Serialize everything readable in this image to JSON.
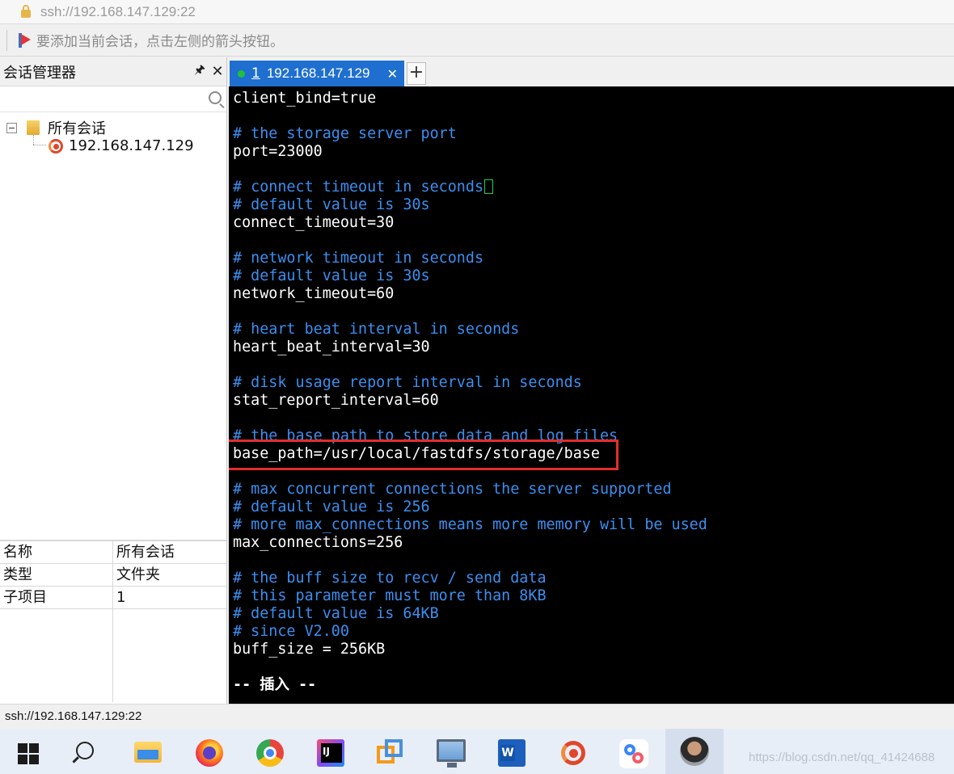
{
  "address_bar": {
    "text": "ssh://192.168.147.129:22"
  },
  "hint_bar": {
    "text": "要添加当前会话，点击左侧的箭头按钮。"
  },
  "session_manager": {
    "title": "会话管理器",
    "pin_glyph": "🖈",
    "close_glyph": "✕",
    "search_placeholder": "",
    "tree": {
      "root_label": "所有会话",
      "children": [
        {
          "label": "192.168.147.129"
        }
      ]
    }
  },
  "properties": {
    "rows": [
      {
        "key": "名称",
        "value": "所有会话"
      },
      {
        "key": "类型",
        "value": "文件夹"
      },
      {
        "key": "子项目",
        "value": "1"
      }
    ]
  },
  "tabs": {
    "active": {
      "number": "1",
      "label": "192.168.147.129",
      "close_glyph": "✕"
    },
    "add_glyph": "+"
  },
  "terminal": {
    "lines": [
      "client_bind=true",
      "",
      "# the storage server port",
      "port=23000",
      "",
      "# connect timeout in seconds",
      "# default value is 30s",
      "connect_timeout=30",
      "",
      "# network timeout in seconds",
      "# default value is 30s",
      "network_timeout=60",
      "",
      "# heart beat interval in seconds",
      "heart_beat_interval=30",
      "",
      "# disk usage report interval in seconds",
      "stat_report_interval=60",
      "",
      "# the base path to store data and log files",
      "base_path=/usr/local/fastdfs/storage/base",
      "",
      "# max concurrent connections the server supported",
      "# default value is 256",
      "# more max_connections means more memory will be used",
      "max_connections=256",
      "",
      "# the buff size to recv / send data",
      "# this parameter must more than 8KB",
      "# default value is 64KB",
      "# since V2.00",
      "buff_size = 256KB",
      "",
      "-- 插入 --"
    ],
    "comment_color": "#3b8ff0",
    "text_color": "#ffffff",
    "highlight_color": "#e32d2d"
  },
  "status_bar": {
    "text": "ssh://192.168.147.129:22"
  },
  "taskbar": {
    "icons": [
      "windows-start-icon",
      "search-icon",
      "file-explorer-icon",
      "firefox-icon",
      "chrome-icon",
      "intellij-idea-icon",
      "vmware-icon",
      "remote-desktop-icon",
      "word-icon",
      "xshell-icon",
      "baidu-netdisk-icon",
      "user-avatar-icon"
    ],
    "watermark": "https://blog.csdn.net/qq_41424688"
  }
}
